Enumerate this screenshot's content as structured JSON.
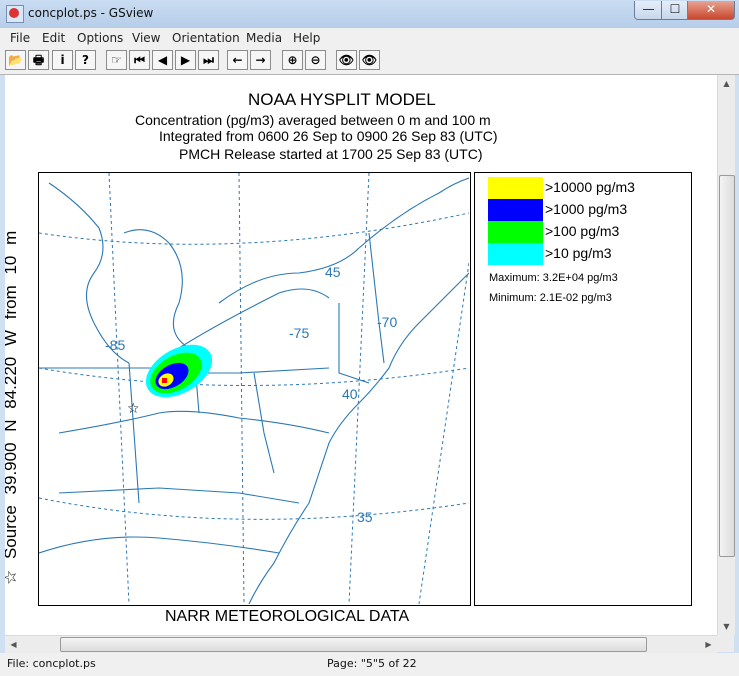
{
  "window": {
    "title": "concplot.ps - GSview",
    "controls": {
      "minimize": "—",
      "maximize": "☐",
      "close": "✕"
    }
  },
  "menu": [
    "File",
    "Edit",
    "Options",
    "View",
    "Orientation",
    "Media",
    "Help"
  ],
  "toolbar": {
    "buttons": [
      {
        "name": "open-icon",
        "glyph": "📂"
      },
      {
        "name": "print-icon",
        "glyph": "🖶"
      },
      {
        "name": "info-icon",
        "glyph": "i"
      },
      {
        "name": "help-icon",
        "glyph": "?"
      },
      {
        "name": "goto-page-icon",
        "glyph": "☞"
      },
      {
        "name": "first-page-icon",
        "glyph": "⏮"
      },
      {
        "name": "prev-page-icon",
        "glyph": "◀"
      },
      {
        "name": "next-page-icon",
        "glyph": "▶"
      },
      {
        "name": "last-page-icon",
        "glyph": "⏭"
      },
      {
        "name": "back-icon",
        "glyph": "←"
      },
      {
        "name": "forward-icon",
        "glyph": "→"
      },
      {
        "name": "zoom-in-icon",
        "glyph": "⊕"
      },
      {
        "name": "zoom-out-icon",
        "glyph": "⊖"
      },
      {
        "name": "find-icon",
        "glyph": "👁"
      },
      {
        "name": "find-next-icon",
        "glyph": "👁"
      }
    ]
  },
  "plot": {
    "title": "NOAA HYSPLIT MODEL",
    "line2": "Concentration  (pg/m3) averaged between      0 m and    100 m",
    "line3": "Integrated from 0600 26 Sep to 0900 26 Sep 83 (UTC)",
    "line4": "PMCH Release started at 1700 25 Sep 83 (UTC)",
    "source_label": "☆ Source  39.900  N  84.220  W    from    10 m",
    "footer": "NARR METEOROLOGICAL DATA",
    "lat_lon_labels": {
      "lon85": "-85",
      "lon75": "-75",
      "lon70": "-70",
      "lat45": "45",
      "lat40": "40",
      "lat35": "35"
    },
    "colors": {
      "c10000": "#ffff00",
      "c1000": "#0000ff",
      "c100": "#00ff00",
      "c10": "#00ffff",
      "map": "#1f6fa8"
    }
  },
  "legend": {
    "items": [
      {
        "label": ">10000 pg/m3",
        "color": "#ffff00"
      },
      {
        "label": ">1000 pg/m3",
        "color": "#0000ff"
      },
      {
        "label": ">100 pg/m3",
        "color": "#00ff00"
      },
      {
        "label": ">10 pg/m3",
        "color": "#00ffff"
      }
    ],
    "maximum": "Maximum: 3.2E+04 pg/m3",
    "minimum": "Minimum: 2.1E-02 pg/m3"
  },
  "status": {
    "file": "File: concplot.ps",
    "page": "Page: \"5\"",
    "of": "5 of 22"
  }
}
